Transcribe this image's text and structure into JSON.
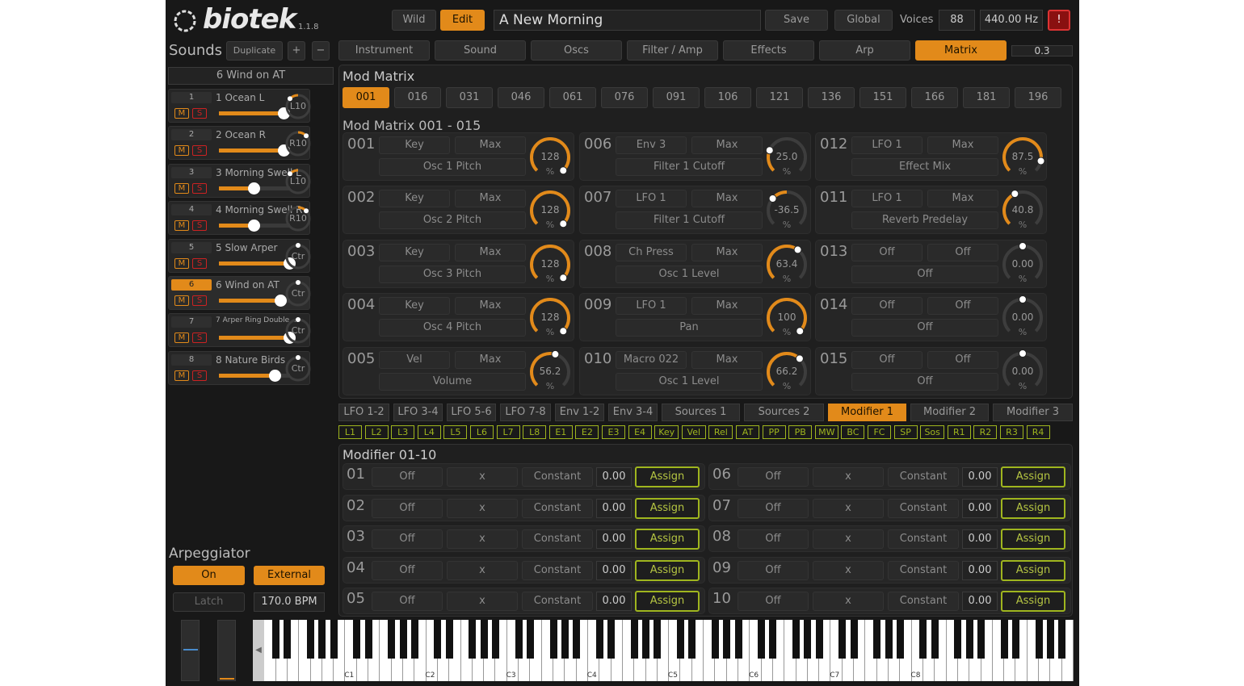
{
  "header": {
    "logo": "biotek",
    "version": "1.1.8",
    "wild": "Wild",
    "edit": "Edit",
    "preset": "A New Morning",
    "save": "Save",
    "global": "Global",
    "voices_label": "Voices",
    "voices": "88",
    "tuning": "440.00 Hz",
    "alert": "!"
  },
  "sounds": {
    "title": "Sounds",
    "duplicate": "Duplicate",
    "plus": "+",
    "minus": "−",
    "selected": "6 Wind on AT"
  },
  "tracks": [
    {
      "n": "1",
      "name": "1 Ocean L",
      "knob": "L10",
      "level": 0.92,
      "pan": 0.33,
      "active": false
    },
    {
      "n": "2",
      "name": "2 Ocean R",
      "knob": "R10",
      "level": 0.92,
      "pan": 0.67,
      "active": false
    },
    {
      "n": "3",
      "name": "3 Morning Swell L",
      "knob": "L10",
      "level": 0.5,
      "pan": 0.33,
      "active": false
    },
    {
      "n": "4",
      "name": "4 Morning Swell R",
      "knob": "R10",
      "level": 0.5,
      "pan": 0.67,
      "active": false
    },
    {
      "n": "5",
      "name": "5 Slow Arper",
      "knob": "Ctr",
      "level": 1.0,
      "pan": 0.5,
      "active": false
    },
    {
      "n": "6",
      "name": "6 Wind on AT",
      "knob": "Ctr",
      "level": 0.88,
      "pan": 0.5,
      "active": true
    },
    {
      "n": "7",
      "name": "7 Arper Ring Double ...",
      "knob": "Ctr",
      "level": 1.0,
      "pan": 0.5,
      "active": false
    },
    {
      "n": "8",
      "name": "8 Nature Birds",
      "knob": "Ctr",
      "level": 0.8,
      "pan": 0.5,
      "active": false
    }
  ],
  "ms": {
    "m": "M",
    "s": "S"
  },
  "tabs": [
    "Instrument",
    "Sound",
    "Oscs",
    "Filter / Amp",
    "Effects",
    "Arp",
    "Matrix"
  ],
  "active_tab": "Matrix",
  "tab_value": "0.3",
  "matrix": {
    "title": "Mod Matrix",
    "pages": [
      "001",
      "016",
      "031",
      "046",
      "061",
      "076",
      "091",
      "106",
      "121",
      "136",
      "151",
      "166",
      "181",
      "196"
    ],
    "subtitle": "Mod Matrix 001 - 015",
    "slots": [
      {
        "id": "001",
        "src": "Key",
        "amt": "Max",
        "dst": "Osc 1 Pitch",
        "val": "128",
        "unit": "%",
        "fill": 1.0
      },
      {
        "id": "002",
        "src": "Key",
        "amt": "Max",
        "dst": "Osc 2 Pitch",
        "val": "128",
        "unit": "%",
        "fill": 1.0
      },
      {
        "id": "003",
        "src": "Key",
        "amt": "Max",
        "dst": "Osc 3 Pitch",
        "val": "128",
        "unit": "%",
        "fill": 1.0
      },
      {
        "id": "004",
        "src": "Key",
        "amt": "Max",
        "dst": "Osc 4 Pitch",
        "val": "128",
        "unit": "%",
        "fill": 1.0
      },
      {
        "id": "005",
        "src": "Vel",
        "amt": "Max",
        "dst": "Volume",
        "val": "56.2",
        "unit": "%",
        "fill": 0.56
      },
      {
        "id": "006",
        "src": "Env 3",
        "amt": "Max",
        "dst": "Filter 1 Cutoff",
        "val": "25.0",
        "unit": "%",
        "fill": 0.25
      },
      {
        "id": "007",
        "src": "LFO 1",
        "amt": "Max",
        "dst": "Filter 1 Cutoff",
        "val": "-36.5",
        "unit": "%",
        "fill": -0.365
      },
      {
        "id": "008",
        "src": "Ch Press",
        "amt": "Max",
        "dst": "Osc 1 Level",
        "val": "63.4",
        "unit": "%",
        "fill": 0.634
      },
      {
        "id": "009",
        "src": "LFO 1",
        "amt": "Max",
        "dst": "Pan",
        "val": "100",
        "unit": "%",
        "fill": 1.0
      },
      {
        "id": "010",
        "src": "Macro 022",
        "amt": "Max",
        "dst": "Osc 1 Level",
        "val": "66.2",
        "unit": "%",
        "fill": 0.662
      },
      {
        "id": "012",
        "src": "LFO 1",
        "amt": "Max",
        "dst": "Effect Mix",
        "val": "87.5",
        "unit": "%",
        "fill": 0.875
      },
      {
        "id": "011",
        "src": "LFO 1",
        "amt": "Max",
        "dst": "Reverb Predelay",
        "val": "40.8",
        "unit": "%",
        "fill": 0.408
      },
      {
        "id": "013",
        "src": "Off",
        "amt": "Off",
        "dst": "Off",
        "val": "0.00",
        "unit": "%",
        "fill": 0
      },
      {
        "id": "014",
        "src": "Off",
        "amt": "Off",
        "dst": "Off",
        "val": "0.00",
        "unit": "%",
        "fill": 0
      },
      {
        "id": "015",
        "src": "Off",
        "amt": "Off",
        "dst": "Off",
        "val": "0.00",
        "unit": "%",
        "fill": 0
      }
    ]
  },
  "lower_tabs": [
    "LFO 1-2",
    "LFO 3-4",
    "LFO 5-6",
    "LFO 7-8",
    "Env 1-2",
    "Env 3-4",
    "Sources 1",
    "Sources 2",
    "Modifier 1",
    "Modifier 2",
    "Modifier 3"
  ],
  "lower_active": "Modifier 1",
  "sources": [
    "L1",
    "L2",
    "L3",
    "L4",
    "L5",
    "L6",
    "L7",
    "L8",
    "E1",
    "E2",
    "E3",
    "E4",
    "Key",
    "Vel",
    "Rel",
    "AT",
    "PP",
    "PB",
    "MW",
    "BC",
    "FC",
    "SP",
    "Sos",
    "R1",
    "R2",
    "R3",
    "R4"
  ],
  "modifier": {
    "title": "Modifier 01-10",
    "rows": [
      {
        "id": "01",
        "a": "Off",
        "op": "x",
        "b": "Constant",
        "val": "0.00",
        "btn": "Assign"
      },
      {
        "id": "02",
        "a": "Off",
        "op": "x",
        "b": "Constant",
        "val": "0.00",
        "btn": "Assign"
      },
      {
        "id": "03",
        "a": "Off",
        "op": "x",
        "b": "Constant",
        "val": "0.00",
        "btn": "Assign"
      },
      {
        "id": "04",
        "a": "Off",
        "op": "x",
        "b": "Constant",
        "val": "0.00",
        "btn": "Assign"
      },
      {
        "id": "05",
        "a": "Off",
        "op": "x",
        "b": "Constant",
        "val": "0.00",
        "btn": "Assign"
      },
      {
        "id": "06",
        "a": "Off",
        "op": "x",
        "b": "Constant",
        "val": "0.00",
        "btn": "Assign"
      },
      {
        "id": "07",
        "a": "Off",
        "op": "x",
        "b": "Constant",
        "val": "0.00",
        "btn": "Assign"
      },
      {
        "id": "08",
        "a": "Off",
        "op": "x",
        "b": "Constant",
        "val": "0.00",
        "btn": "Assign"
      },
      {
        "id": "09",
        "a": "Off",
        "op": "x",
        "b": "Constant",
        "val": "0.00",
        "btn": "Assign"
      },
      {
        "id": "10",
        "a": "Off",
        "op": "x",
        "b": "Constant",
        "val": "0.00",
        "btn": "Assign"
      }
    ]
  },
  "arp": {
    "title": "Arpeggiator",
    "on": "On",
    "external": "External",
    "latch": "Latch",
    "bpm": "170.0 BPM"
  },
  "keyboard": {
    "octaves": [
      "C1",
      "C2",
      "C3",
      "C4",
      "C5",
      "C6",
      "C7",
      "C8"
    ]
  },
  "colors": {
    "accent": "#e28a1a",
    "green": "#9fb51e",
    "bg": "#181818"
  }
}
